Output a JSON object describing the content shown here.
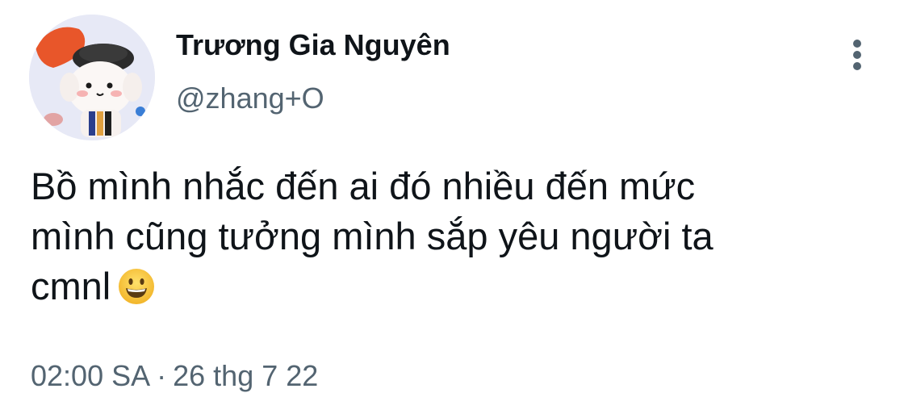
{
  "tweet": {
    "author": {
      "display_name": "Trương Gia Nguyên",
      "handle": "@zhang+O",
      "avatar": "chibi-character-avatar"
    },
    "more_icon": "vertical-ellipsis-icon",
    "text_lines": [
      "Bồ mình nhắc đến ai đó nhiều đến mức",
      "mình cũng tưởng mình sắp yêu người ta",
      "cmnl"
    ],
    "emoji": "grinning-face-emoji",
    "time": "02:00 SA",
    "separator": "·",
    "date": "26 thg 7 22"
  },
  "colors": {
    "text_primary": "#0f1419",
    "text_secondary": "#536471",
    "avatar_bg": "#e7e9f6"
  }
}
